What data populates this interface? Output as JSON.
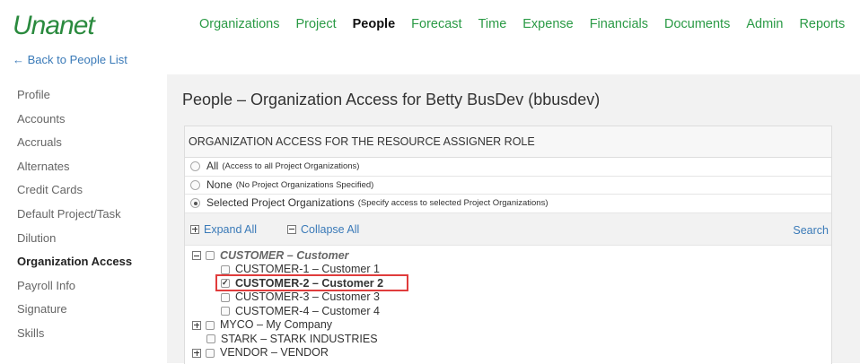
{
  "app": {
    "logo": "Unanet"
  },
  "topnav": {
    "items": [
      "Organizations",
      "Project",
      "People",
      "Forecast",
      "Time",
      "Expense",
      "Financials",
      "Documents",
      "Admin",
      "Reports"
    ],
    "active": "People"
  },
  "back_link": "← Back to People List",
  "sidebar": {
    "items": [
      "Profile",
      "Accounts",
      "Accruals",
      "Alternates",
      "Credit Cards",
      "Default Project/Task",
      "Dilution",
      "Organization Access",
      "Payroll Info",
      "Signature",
      "Skills"
    ],
    "active": "Organization Access"
  },
  "page_title": "People – Organization Access for Betty BusDev (bbusdev)",
  "panel": {
    "header": "ORGANIZATION ACCESS FOR THE RESOURCE ASSIGNER ROLE",
    "options": [
      {
        "label": "All",
        "note": "(Access to all Project Organizations)",
        "selected": false
      },
      {
        "label": "None",
        "note": "(No Project Organizations Specified)",
        "selected": false
      },
      {
        "label": "Selected Project Organizations",
        "note": "(Specify access to selected Project Organizations)",
        "selected": true
      }
    ],
    "toolbar": {
      "expand_all": "Expand All",
      "collapse_all": "Collapse All",
      "search": "Search"
    },
    "tree": {
      "customer": "CUSTOMER – Customer",
      "customer_children": [
        "CUSTOMER-1 – Customer 1",
        "CUSTOMER-2 – Customer 2",
        "CUSTOMER-3 – Customer 3",
        "CUSTOMER-4 – Customer 4"
      ],
      "myco": "MYCO – My Company",
      "stark": "STARK – STARK INDUSTRIES",
      "vendor": "VENDOR – VENDOR"
    }
  },
  "colors": {
    "brand": "#2a8a3e",
    "nav": "#2a9a45",
    "link": "#3a7ab8",
    "highlight": "#e03c3c"
  }
}
